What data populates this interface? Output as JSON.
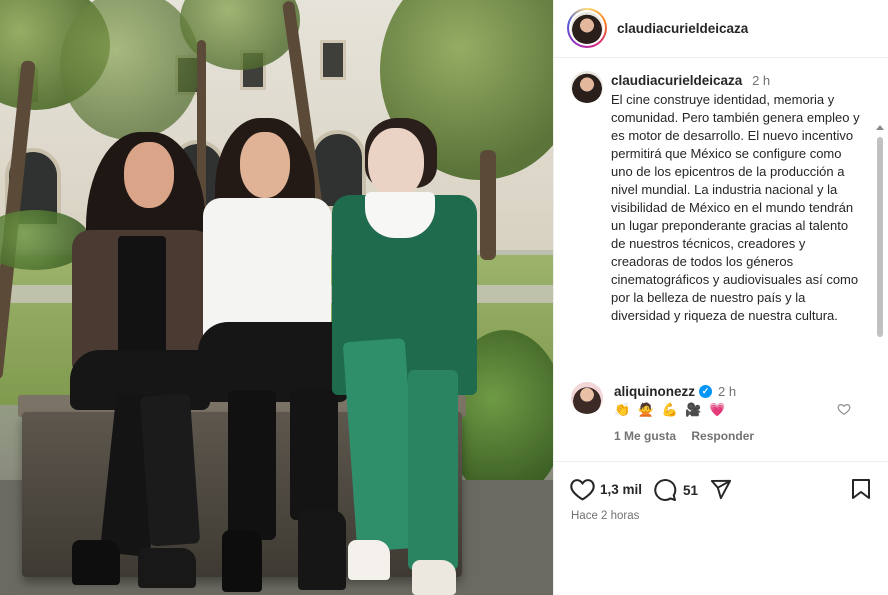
{
  "post": {
    "username": "claudiacurieldeicaza",
    "caption": {
      "username": "claudiacurieldeicaza",
      "time": "2 h",
      "text": "El cine construye identidad, memoria y comunidad. Pero también genera empleo y es motor de desarrollo. El nuevo incentivo permitirá que México se configure como uno de los epicentros de la producción a nivel mundial. La industria nacional y la visibilidad de México en el mundo tendrán un lugar preponderante gracias al talento de nuestros técnicos, creadores y creadoras de todos los géneros cinematográficos y audiovisuales así como por la belleza de nuestro país y la diversidad y riqueza de nuestra cultura."
    },
    "comment": {
      "username": "aliquinonezz",
      "verified": true,
      "time": "2 h",
      "emojis": "👏 🙅 💪 🎥 💗",
      "likes_label": "1 Me gusta",
      "reply_label": "Responder"
    },
    "actions": {
      "likes": "1,3 mil",
      "comments": "51",
      "icons": [
        "heart-icon",
        "comment-icon",
        "share-icon",
        "bookmark-icon"
      ]
    },
    "posted_ago": "Hace 2 horas"
  },
  "colors": {
    "text": "#262626",
    "muted": "#737373",
    "verified": "#0095f6",
    "ring": [
      "#feda75",
      "#fa7e1e",
      "#d62976",
      "#962fbf",
      "#4f5bd5"
    ]
  }
}
